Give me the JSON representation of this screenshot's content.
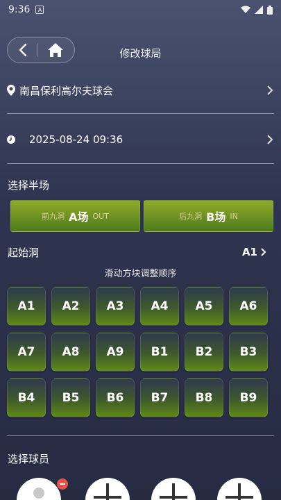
{
  "status_bar": {
    "time": "9:36",
    "badge": "A"
  },
  "page": {
    "title": "修改球局"
  },
  "course": {
    "name": "南昌保利高尔夫球会"
  },
  "datetime": {
    "value": "2025-08-24 09:36"
  },
  "half_section": {
    "title": "选择半场",
    "options": [
      {
        "sub_left": "前九洞",
        "main": "A场",
        "sub_right": "OUT"
      },
      {
        "sub_left": "后九洞",
        "main": "B场",
        "sub_right": "IN"
      }
    ]
  },
  "start_hole": {
    "label": "起始洞",
    "value": "A1"
  },
  "hint": "滑动方块调整顺序",
  "holes": [
    "A1",
    "A2",
    "A3",
    "A4",
    "A5",
    "A6",
    "A7",
    "A8",
    "A9",
    "B1",
    "B2",
    "B3",
    "B4",
    "B5",
    "B6",
    "B7",
    "B8",
    "B9"
  ],
  "players_section": {
    "title": "选择球员"
  },
  "colors": {
    "accent_green": "#6e9a20",
    "background": "#2f3550",
    "remove_badge": "#e5534b"
  },
  "icons": [
    "back-icon",
    "home-icon",
    "location-pin-icon",
    "clock-icon",
    "chevron-right-icon",
    "wifi-icon",
    "signal-icon",
    "battery-icon",
    "remove-icon",
    "plus-icon"
  ]
}
